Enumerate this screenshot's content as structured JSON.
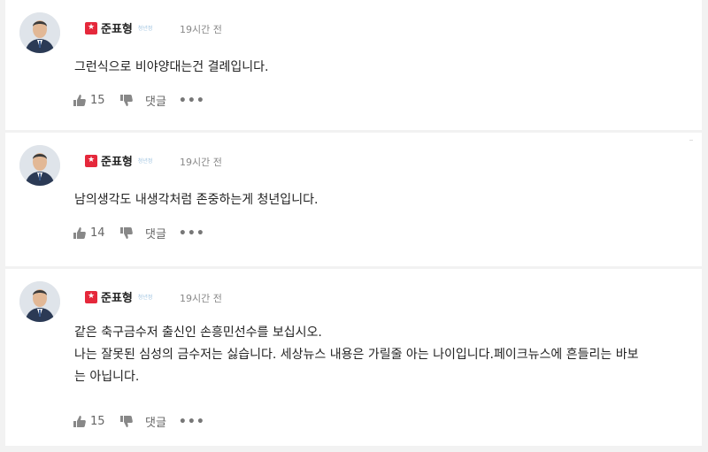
{
  "comments": [
    {
      "author": "준표형",
      "author_tag": "청년정",
      "time": "19시간 전",
      "lines": [
        "그런식으로 비야양대는건 결례입니다."
      ],
      "likes": "15",
      "reply_label": "댓글",
      "more_label": "•••"
    },
    {
      "author": "준표형",
      "author_tag": "청년정",
      "time": "19시간 전",
      "lines": [
        "남의생각도 내생각처럼 존중하는게 청년입니다."
      ],
      "likes": "14",
      "reply_label": "댓글",
      "more_label": "•••"
    },
    {
      "author": "준표형",
      "author_tag": "청년정",
      "time": "19시간 전",
      "lines": [
        "같은 축구금수저 출신인 손흥민선수를 보십시오.",
        "나는 잘못된 심성의 금수저는 싫습니다. 세상뉴스 내용은 가릴줄 아는 나이입니다.페이크뉴스에 흔들리는 바보",
        "는 아닙니다."
      ],
      "likes": "15",
      "reply_label": "댓글",
      "more_label": "•••"
    }
  ],
  "colors": {
    "party_badge": "#e5283b",
    "meta_text": "#888888"
  },
  "icons": {
    "like": "thumbs-up-icon",
    "dislike": "thumbs-down-icon",
    "party": "star-icon"
  }
}
